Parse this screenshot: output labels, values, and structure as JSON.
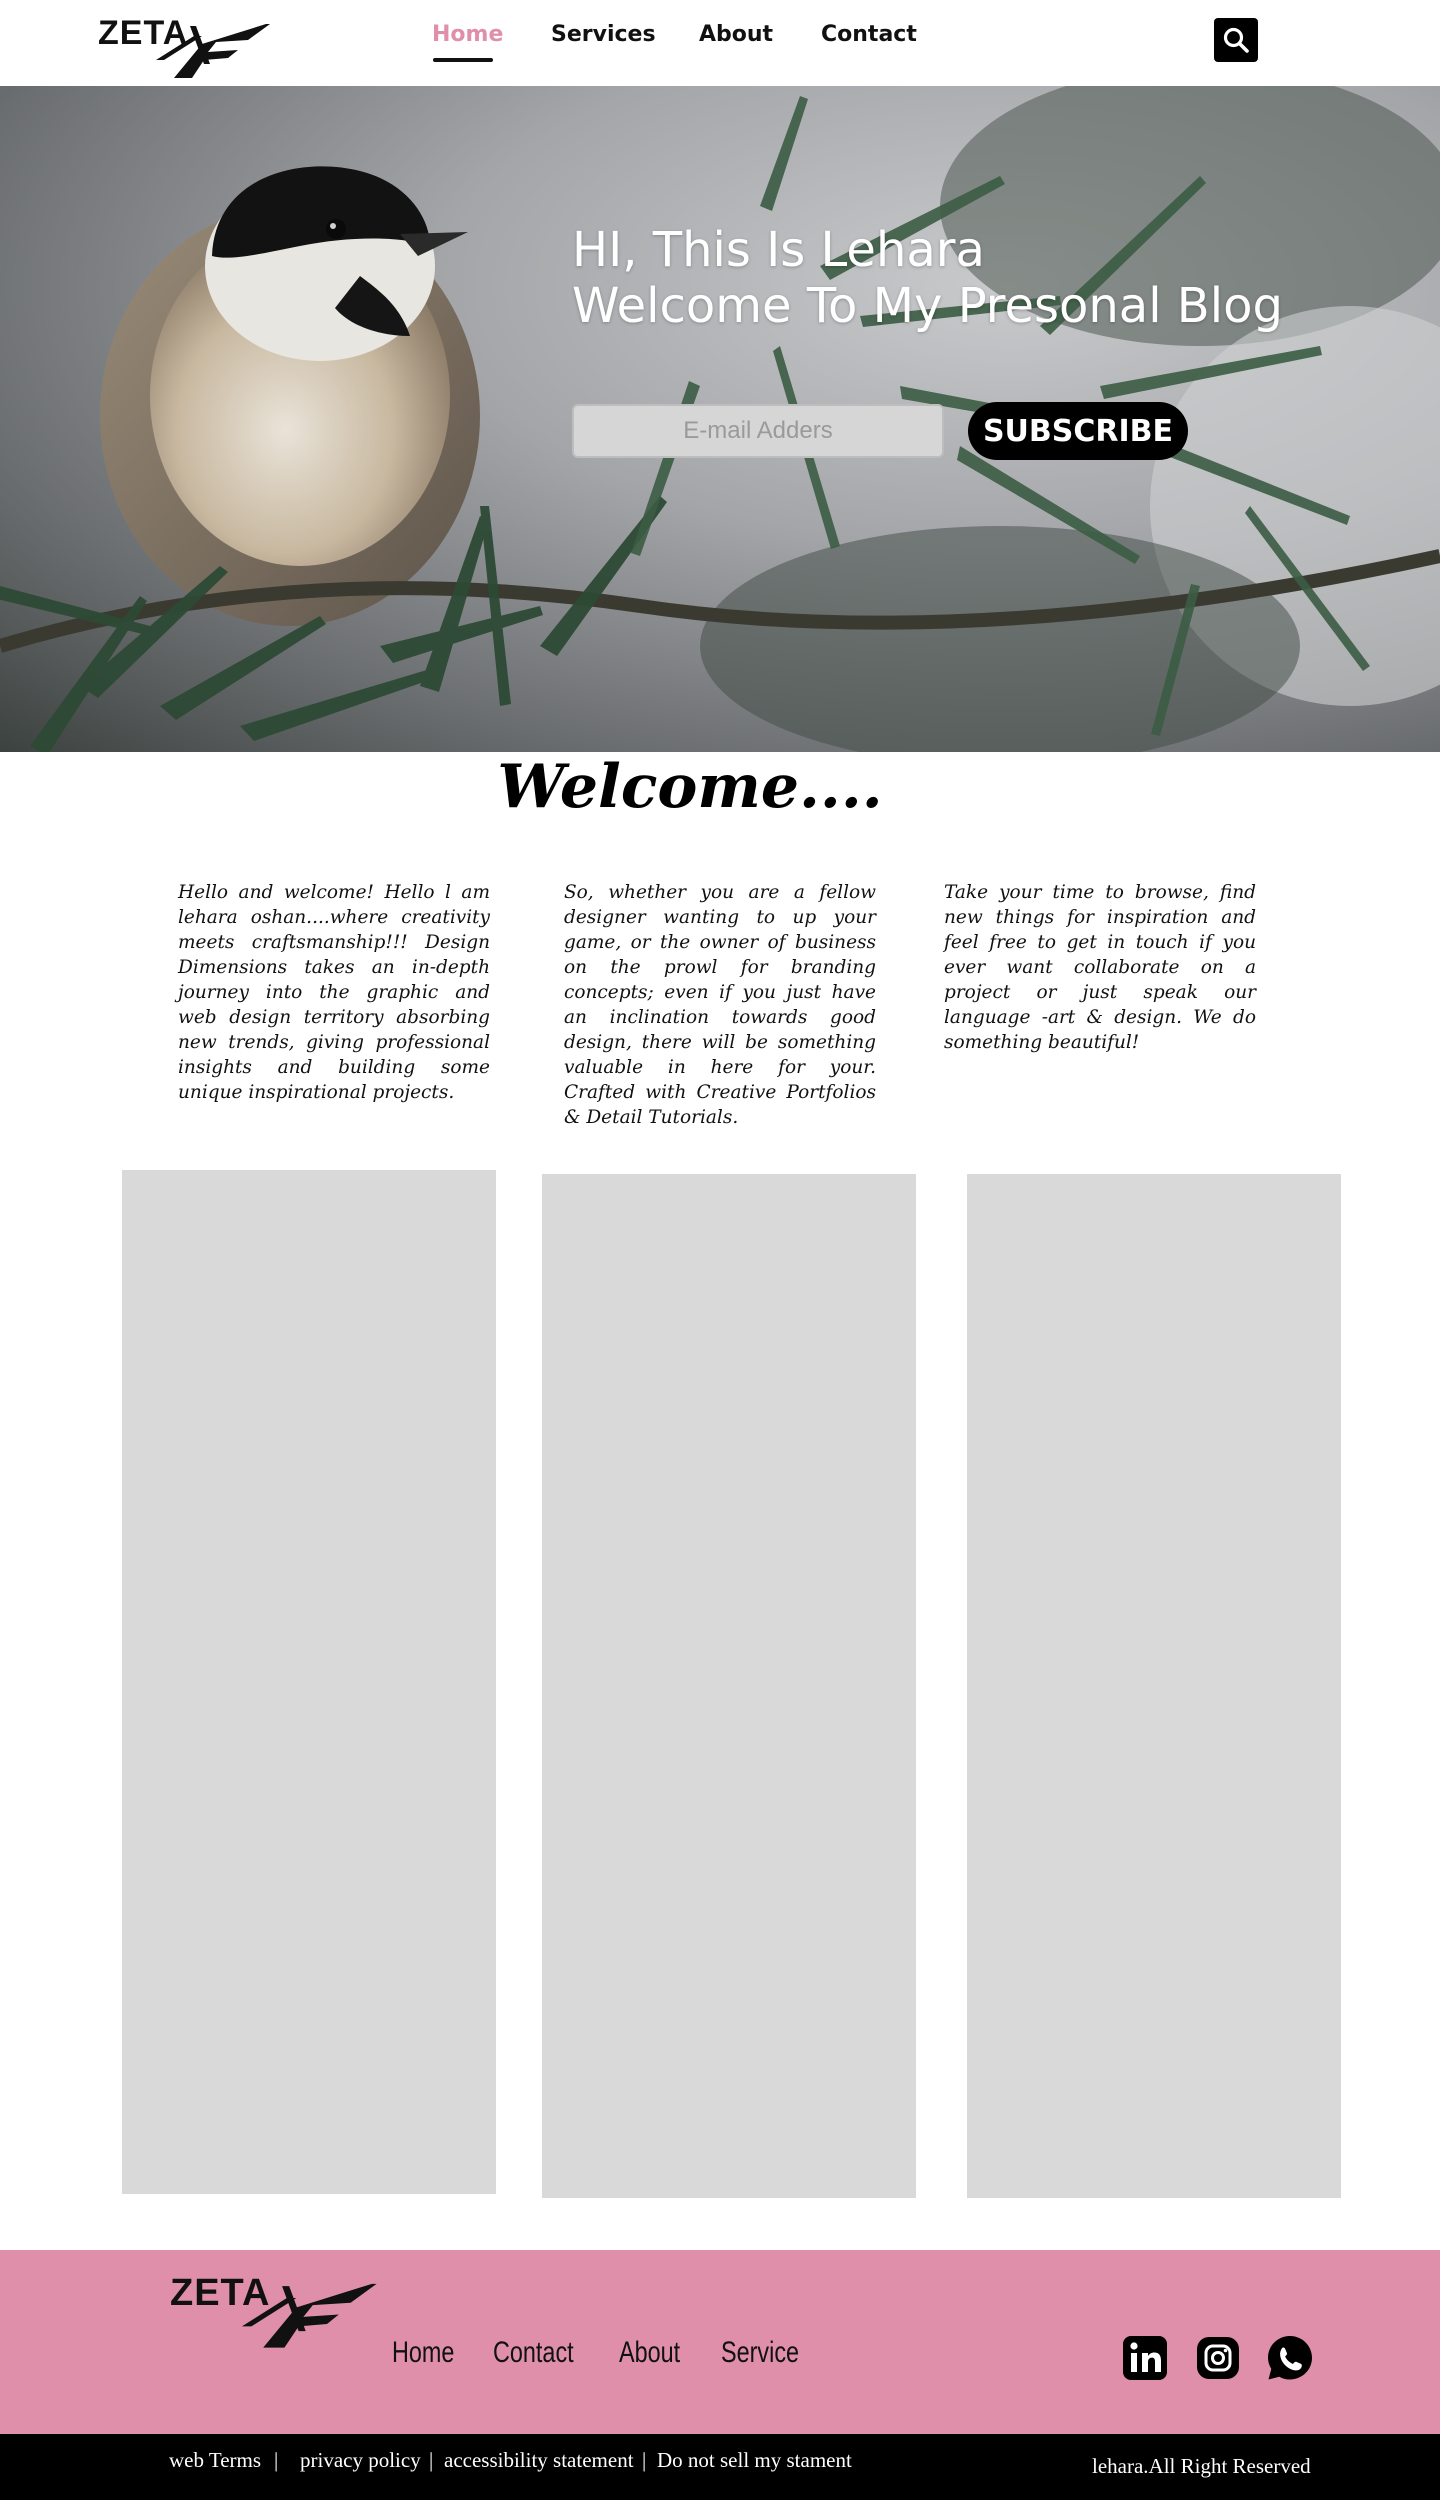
{
  "header": {
    "logo_text": "ZETA",
    "nav": [
      {
        "label": "Home",
        "active": true
      },
      {
        "label": "Services",
        "active": false
      },
      {
        "label": "About",
        "active": false
      },
      {
        "label": "Contact",
        "active": false
      }
    ],
    "search_icon": "search-icon"
  },
  "hero": {
    "title_line1": "HI, This Is Lehara",
    "title_line2": "Welcome To My Presonal Blog",
    "email_placeholder": "E-mail Adders",
    "subscribe_label": "SUBSCRIBE"
  },
  "welcome": {
    "title": "Welcome....",
    "columns": [
      "Hello and welcome! Hello l am lehara oshan....where creativity meets craftsmanship!!! Design Dimensions takes an in-depth journey into the graphic and web design territory absorbing new trends, giving professional insights and building some unique inspirational projects.",
      "So, whether you are a fellow designer wanting to up your game, or the owner of business on the prowl for branding concepts; even if you just have an inclination towards good design, there will be something valuable in here for your. Crafted with Creative Portfolios & Detail Tutorials.",
      "Take your time to browse, find new things for inspiration and feel free to get in touch if you ever want collaborate on a project or just speak our language -art & design. We do something beautiful!"
    ]
  },
  "footer": {
    "logo_text": "ZETA",
    "nav": [
      "Home",
      "Contact",
      "About",
      "Service"
    ],
    "social": [
      "linkedin-icon",
      "instagram-icon",
      "whatsapp-icon"
    ],
    "legal": [
      "web Terms",
      "privacy policy",
      "accessibility statement",
      "Do not sell my stament"
    ],
    "copyright": "lehara.All Right Reserved"
  },
  "colors": {
    "accent_pink": "#e08fab",
    "placeholder_gray": "#d9d9d9",
    "black": "#000000"
  }
}
